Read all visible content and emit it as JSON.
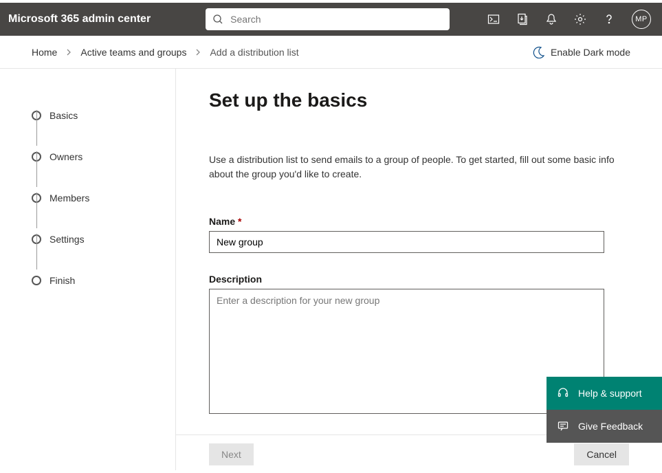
{
  "header": {
    "brand": "Microsoft 365 admin center",
    "search_placeholder": "Search",
    "avatar_initials": "MP"
  },
  "subheader": {
    "crumbs": [
      "Home",
      "Active teams and groups",
      "Add a distribution list"
    ],
    "dark_mode_label": "Enable Dark mode"
  },
  "steps": {
    "items": [
      {
        "label": "Basics"
      },
      {
        "label": "Owners"
      },
      {
        "label": "Members"
      },
      {
        "label": "Settings"
      },
      {
        "label": "Finish"
      }
    ]
  },
  "main": {
    "title": "Set up the basics",
    "description": "Use a distribution list to send emails to a group of people. To get started, fill out some basic info about the group you'd like to create.",
    "name_label": "Name",
    "name_value": "New group",
    "desc_label": "Description",
    "desc_placeholder": "Enter a description for your new group"
  },
  "footer": {
    "next_label": "Next",
    "cancel_label": "Cancel"
  },
  "float": {
    "help_label": "Help & support",
    "feedback_label": "Give Feedback"
  }
}
